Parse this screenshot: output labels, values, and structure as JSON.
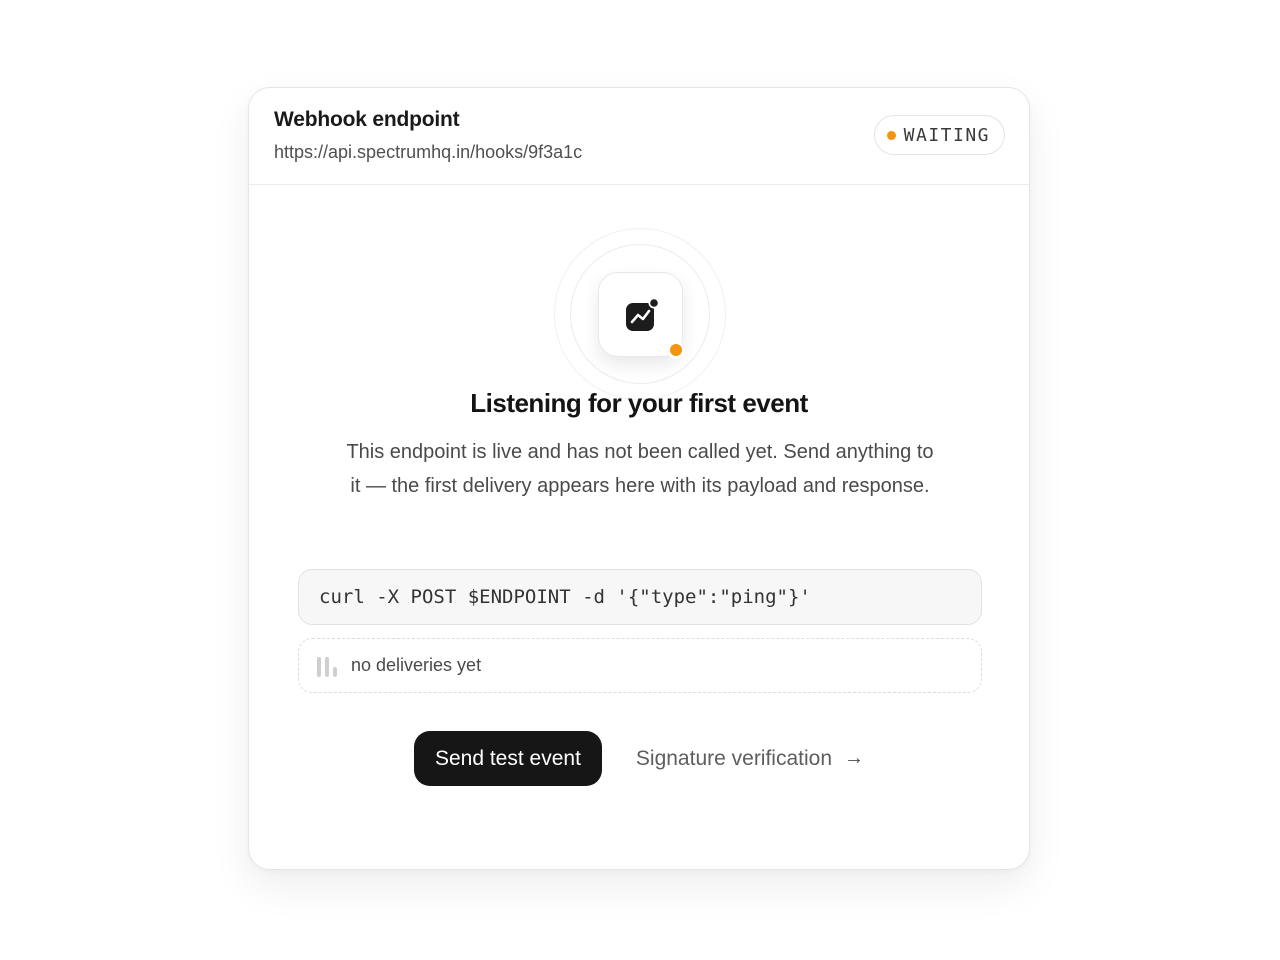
{
  "header": {
    "title": "Webhook endpoint",
    "url": "https://api.spectrumhq.in/hooks/9f3a1c",
    "status": "WAITING"
  },
  "empty_state": {
    "heading": "Listening for your first event",
    "description": "This endpoint is live and has not been called yet. Send anything to it — the first delivery appears here with its payload and response.",
    "command": "curl -X POST $ENDPOINT -d '{\"type\":\"ping\"}'",
    "deliveries_text": "no deliveries yet",
    "icon": "activity-chart-icon"
  },
  "actions": {
    "primary_label": "Send test event",
    "secondary_label": "Signature verification",
    "secondary_arrow": "→"
  },
  "colors": {
    "accent": "#f5950f",
    "primary_button": "#161616"
  }
}
